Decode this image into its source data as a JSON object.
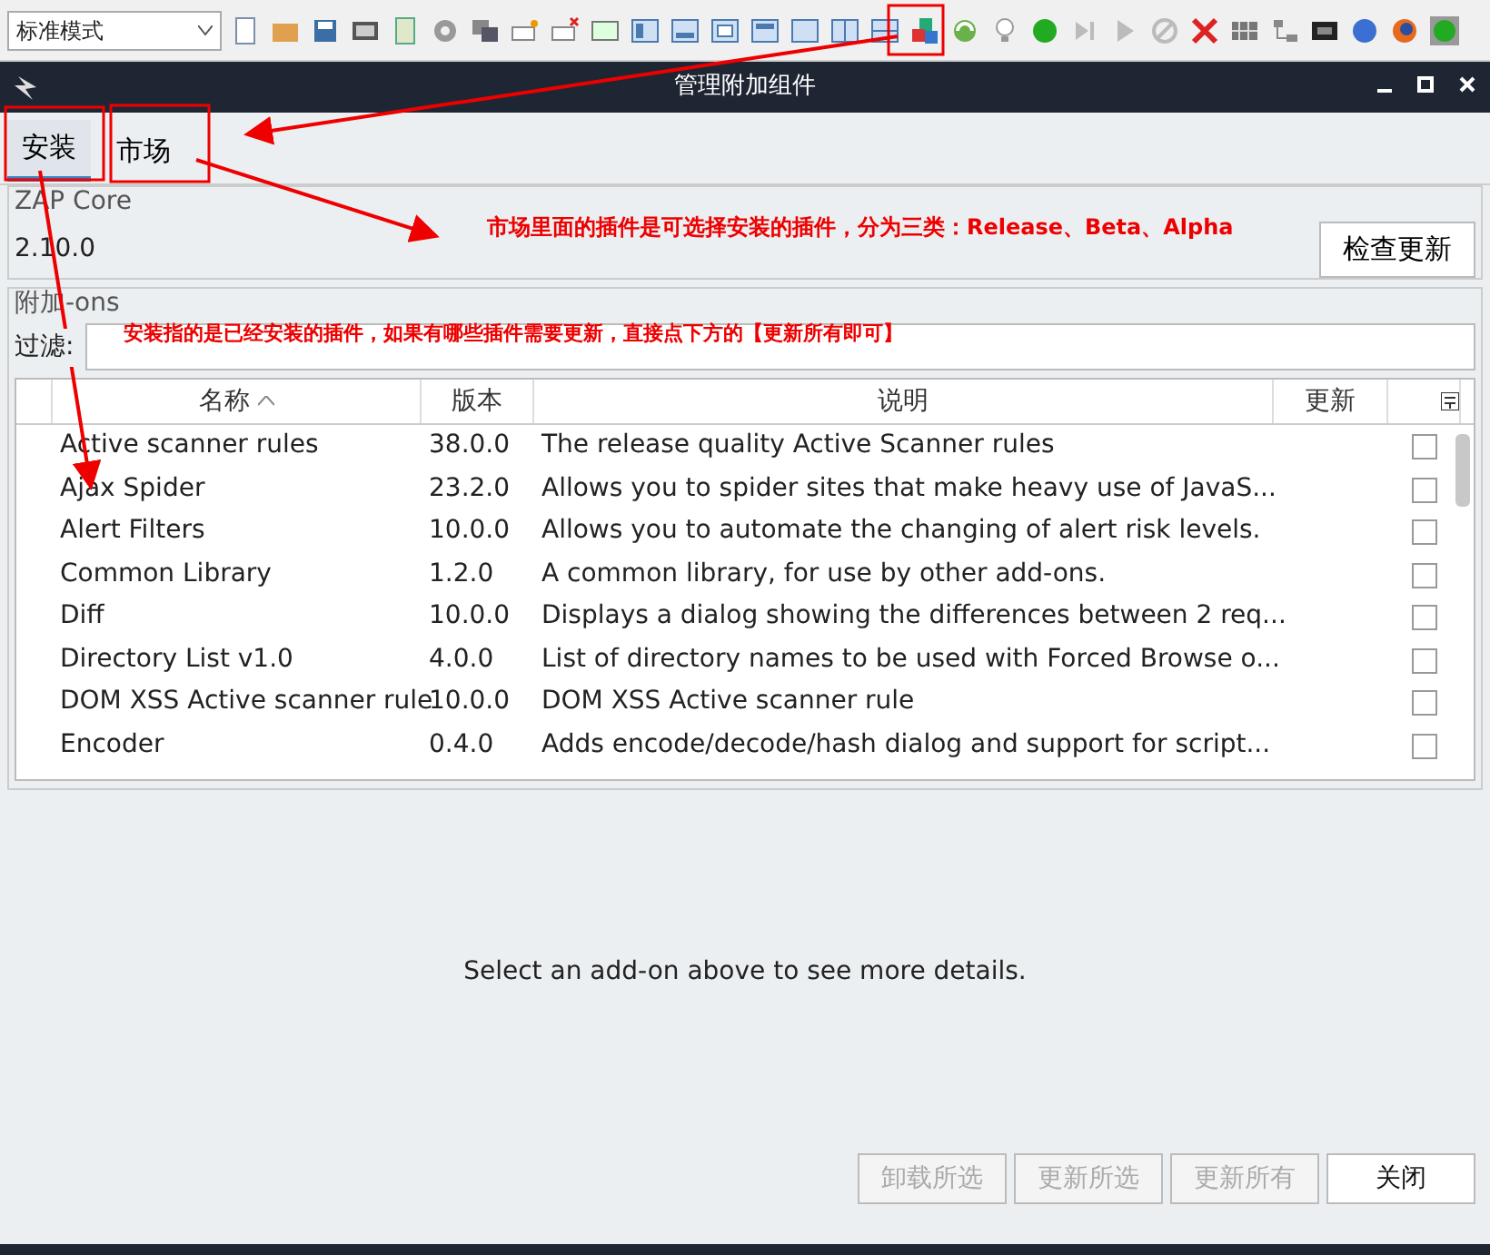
{
  "toolbar": {
    "mode_select": "标准模式"
  },
  "window": {
    "title": "管理附加组件"
  },
  "tabs": [
    {
      "label": "安装",
      "selected": true
    },
    {
      "label": "市场",
      "selected": false
    }
  ],
  "core": {
    "group_title": "ZAP Core",
    "version": "2.10.0",
    "check_button": "检查更新"
  },
  "addons": {
    "group_title": "附加-ons",
    "filter_label": "过滤:",
    "columns": [
      "名称",
      "版本",
      "说明",
      "更新"
    ],
    "rows": [
      {
        "name": "Active scanner rules",
        "version": "38.0.0",
        "description": "The release quality Active Scanner rules",
        "checked": false
      },
      {
        "name": "Ajax Spider",
        "version": "23.2.0",
        "description": "Allows you to spider sites that make heavy use of JavaS...",
        "checked": false
      },
      {
        "name": "Alert Filters",
        "version": "10.0.0",
        "description": "Allows you to automate the changing of alert risk levels.",
        "checked": false
      },
      {
        "name": "Common Library",
        "version": "1.2.0",
        "description": "A common library, for use by other add-ons.",
        "checked": false
      },
      {
        "name": "Diff",
        "version": "10.0.0",
        "description": "Displays a dialog showing the differences between 2 req...",
        "checked": false
      },
      {
        "name": "Directory List v1.0",
        "version": "4.0.0",
        "description": "List of directory names to be used with Forced Browse o...",
        "checked": false
      },
      {
        "name": "DOM XSS Active scanner rule",
        "version": "10.0.0",
        "description": "DOM XSS Active scanner rule",
        "checked": false
      },
      {
        "name": "Encoder",
        "version": "0.4.0",
        "description": "Adds encode/decode/hash dialog and support for script...",
        "checked": false
      }
    ]
  },
  "details": "Select an add-on above to see more details.",
  "buttons": [
    {
      "label": "卸载所选",
      "disabled": true
    },
    {
      "label": "更新所选",
      "disabled": true
    },
    {
      "label": "更新所有",
      "disabled": true
    },
    {
      "label": "关闭",
      "disabled": false
    }
  ],
  "annotations": [
    {
      "kind": "market",
      "text": "市场里面的插件是可选择安装的插件，分为三类：**Release、Beta、Alpha**"
    },
    {
      "kind": "installed",
      "text": "安装指的是已经安装的插件，如果有哪些插件需要更新，直接点下方的【更新所有即可】"
    }
  ]
}
